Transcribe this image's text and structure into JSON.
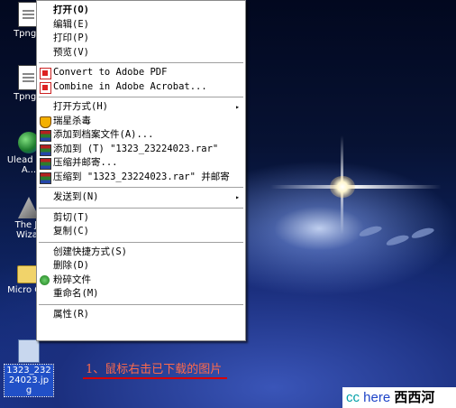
{
  "desktop": {
    "icons": [
      {
        "label": "Tpng.c"
      },
      {
        "label": "Tpng.c"
      },
      {
        "label": "Ulead GIF A..."
      },
      {
        "label": "The JP Wizar"
      },
      {
        "label": "Micro Offi"
      },
      {
        "label": "1323_232\n24023.jp\ng"
      }
    ]
  },
  "context_menu": {
    "items": [
      {
        "label": "打开(O)",
        "icon": null
      },
      {
        "label": "编辑(E)",
        "icon": null
      },
      {
        "label": "打印(P)",
        "icon": null
      },
      {
        "label": "预览(V)",
        "icon": null
      },
      {
        "label": "Convert to Adobe PDF",
        "icon": "pdf-icon"
      },
      {
        "label": "Combine in Adobe Acrobat...",
        "icon": "pdf-icon"
      },
      {
        "label": "打开方式(H)",
        "icon": null
      },
      {
        "label": "瑞星杀毒",
        "icon": "antivirus-icon"
      },
      {
        "label": "添加到档案文件(A)...",
        "icon": "rar-icon"
      },
      {
        "label": "添加到 (T) \"1323_23224023.rar\"",
        "icon": "rar-icon"
      },
      {
        "label": "压缩并邮寄...",
        "icon": "rar-icon"
      },
      {
        "label": "压缩到 \"1323_23224023.rar\" 并邮寄",
        "icon": "rar-icon"
      },
      {
        "label": "发送到(N)",
        "icon": null
      },
      {
        "label": "剪切(T)",
        "icon": null
      },
      {
        "label": "复制(C)",
        "icon": null
      },
      {
        "label": "创建快捷方式(S)",
        "icon": null
      },
      {
        "label": "删除(D)",
        "icon": null
      },
      {
        "label": "粉碎文件",
        "icon": "shred-icon"
      },
      {
        "label": "重命名(M)",
        "icon": null
      },
      {
        "label": "属性(R)",
        "icon": null
      }
    ],
    "submenu_arrow": "▸"
  },
  "caption": "1、鼠标右击已下载的图片",
  "watermark": {
    "part1": "cc",
    "part2": "here",
    "part3": "西西河"
  }
}
